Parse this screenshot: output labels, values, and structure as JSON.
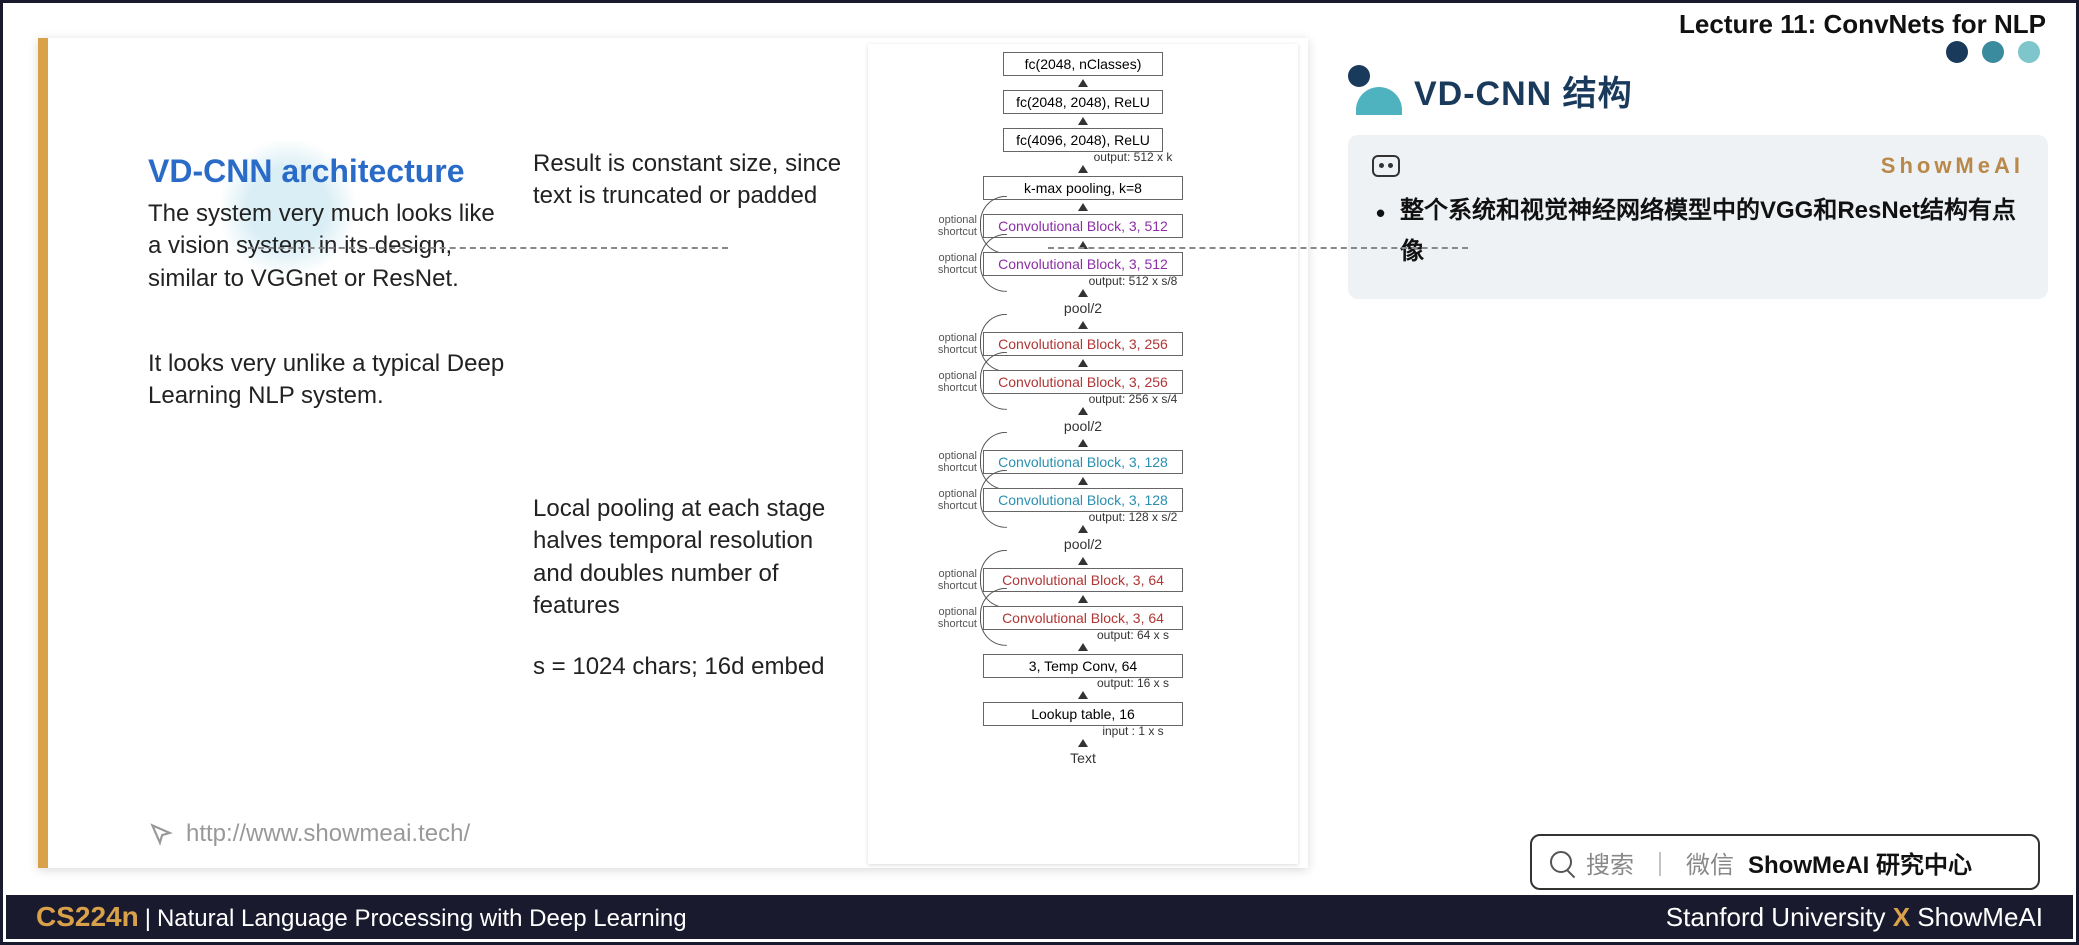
{
  "header": {
    "lecture": "Lecture 11: ConvNets for NLP"
  },
  "left": {
    "title": "VD-CNN architecture",
    "para1": "The system very much looks like a vision system in its design, similar to VGGnet or ResNet.",
    "para2": "It looks very unlike a typical Deep Learning NLP system.",
    "note_top": "Result is constant size, since text is truncated or padded",
    "note_mid": "Local pooling at each stage halves temporal resolution and doubles number of features",
    "note_bottom": "s = 1024 chars; 16d embed",
    "url": "http://www.showmeai.tech/"
  },
  "arch": {
    "fc3": "fc(2048, nClasses)",
    "fc2": "fc(2048, 2048), ReLU",
    "fc1": "fc(4096, 2048), ReLU",
    "out512k": "output: 512 x k",
    "kmax": "k-max pooling, k=8",
    "cb512a": "Convolutional Block, 3, 512",
    "cb512b": "Convolutional Block, 3, 512",
    "out512s8": "output: 512 x s/8",
    "pool": "pool/2",
    "cb256a": "Convolutional Block, 3, 256",
    "cb256b": "Convolutional Block, 3, 256",
    "out256s4": "output: 256 x s/4",
    "cb128a": "Convolutional Block, 3, 128",
    "cb128b": "Convolutional Block, 3, 128",
    "out128s2": "output: 128 x s/2",
    "cb64a": "Convolutional Block, 3, 64",
    "cb64b": "Convolutional Block, 3, 64",
    "out64s": "output: 64 x s",
    "tempconv": "3, Temp Conv, 64",
    "out16s": "output: 16 x s",
    "lookup": "Lookup table, 16",
    "input1s": "input : 1 x s",
    "text": "Text",
    "shortcut": "optional shortcut"
  },
  "right": {
    "title": "VD-CNN 结构",
    "brand": "ShowMeAI",
    "bullet": "整个系统和视觉神经网络模型中的VGG和ResNet结构有点像"
  },
  "search": {
    "hint1": "搜索",
    "sep": "｜",
    "hint2": "微信",
    "bold": "ShowMeAI 研究中心"
  },
  "footer": {
    "code": "CS224n",
    "pipe": " | ",
    "course": "Natural Language Processing with Deep Learning",
    "uni": "Stanford University",
    "x": " X ",
    "brand": "ShowMeAI"
  }
}
